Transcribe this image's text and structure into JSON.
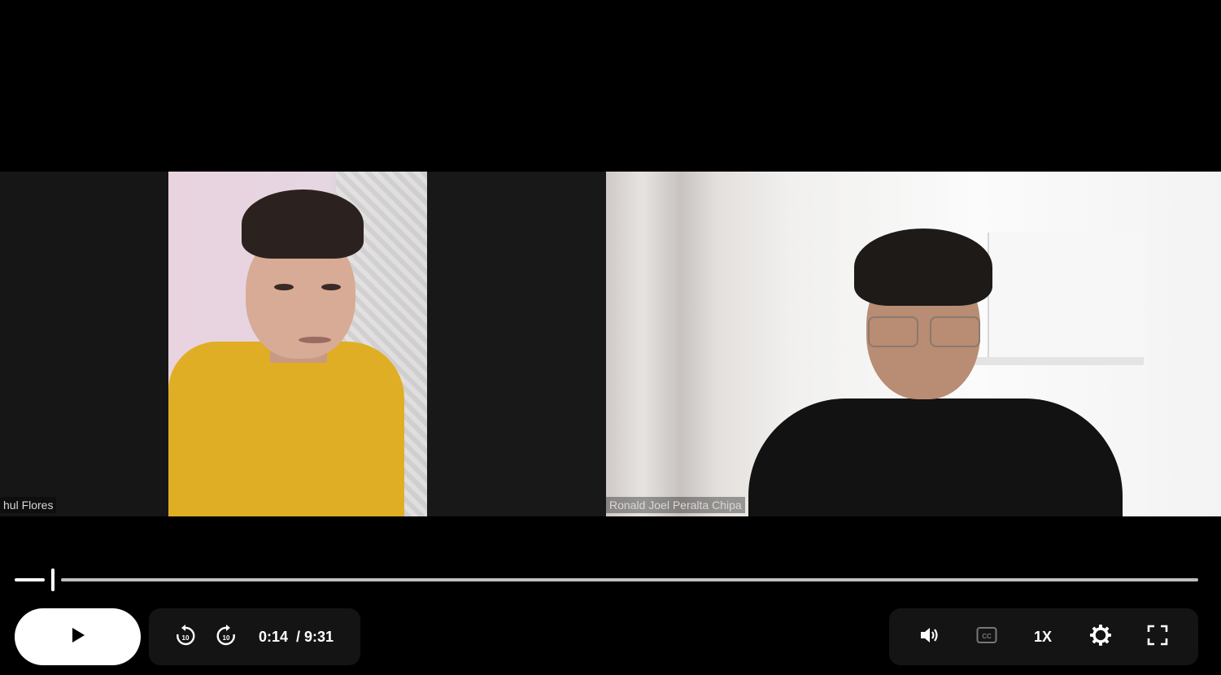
{
  "video": {
    "participants": [
      {
        "name": "hul Flores"
      },
      {
        "name": "Ronald Joel Peralta Chipa"
      }
    ]
  },
  "player": {
    "progress_fraction": 0.025,
    "current_time": "0:14",
    "duration": "/ 9:31",
    "speed": "1X",
    "icons": {
      "play": "play-icon",
      "rewind": "rewind-10-icon",
      "forward": "forward-10-icon",
      "volume": "volume-icon",
      "captions": "captions-icon",
      "settings": "gear-icon",
      "fullscreen": "fullscreen-icon"
    }
  }
}
